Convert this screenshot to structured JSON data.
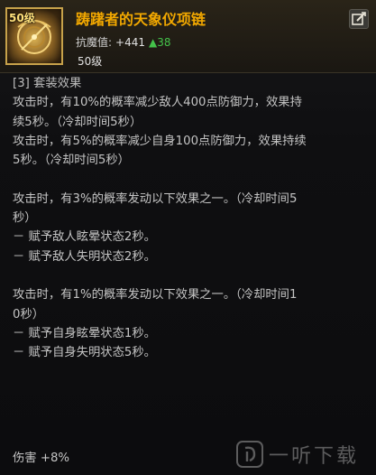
{
  "item": {
    "title": "踌躇者的天象仪项链",
    "badge": "50级",
    "stat_label": "抗魔值:",
    "stat_value": "+441",
    "stat_delta": "▲38",
    "level": "50级",
    "icon": "astrolabe-necklace-icon",
    "edit_icon": "edit-icon"
  },
  "set_effect": {
    "header": "[3] 套装效果",
    "lines": [
      "攻击时，有10%的概率减少敌人400点防御力，效果持",
      "续5秒。（冷却时间5秒）",
      "攻击时，有5%的概率减少自身100点防御力，效果持续",
      "5秒。（冷却时间5秒）",
      "",
      "攻击时，有3%的概率发动以下效果之一。（冷却时间5",
      "秒）",
      "－ 赋予敌人眩晕状态2秒。",
      "－ 赋予敌人失明状态2秒。",
      "",
      "攻击时，有1%的概率发动以下效果之一。（冷却时间1",
      "0秒）",
      "－ 赋予自身眩晕状态1秒。",
      "－ 赋予自身失明状态5秒。",
      ""
    ],
    "footer": "伤害 +8%"
  },
  "watermark": {
    "logo": "ear-logo-icon",
    "text": "一听下载"
  },
  "colors": {
    "title": "#f2a800",
    "stat_up": "#44c24a",
    "text": "#c4c4c4"
  }
}
